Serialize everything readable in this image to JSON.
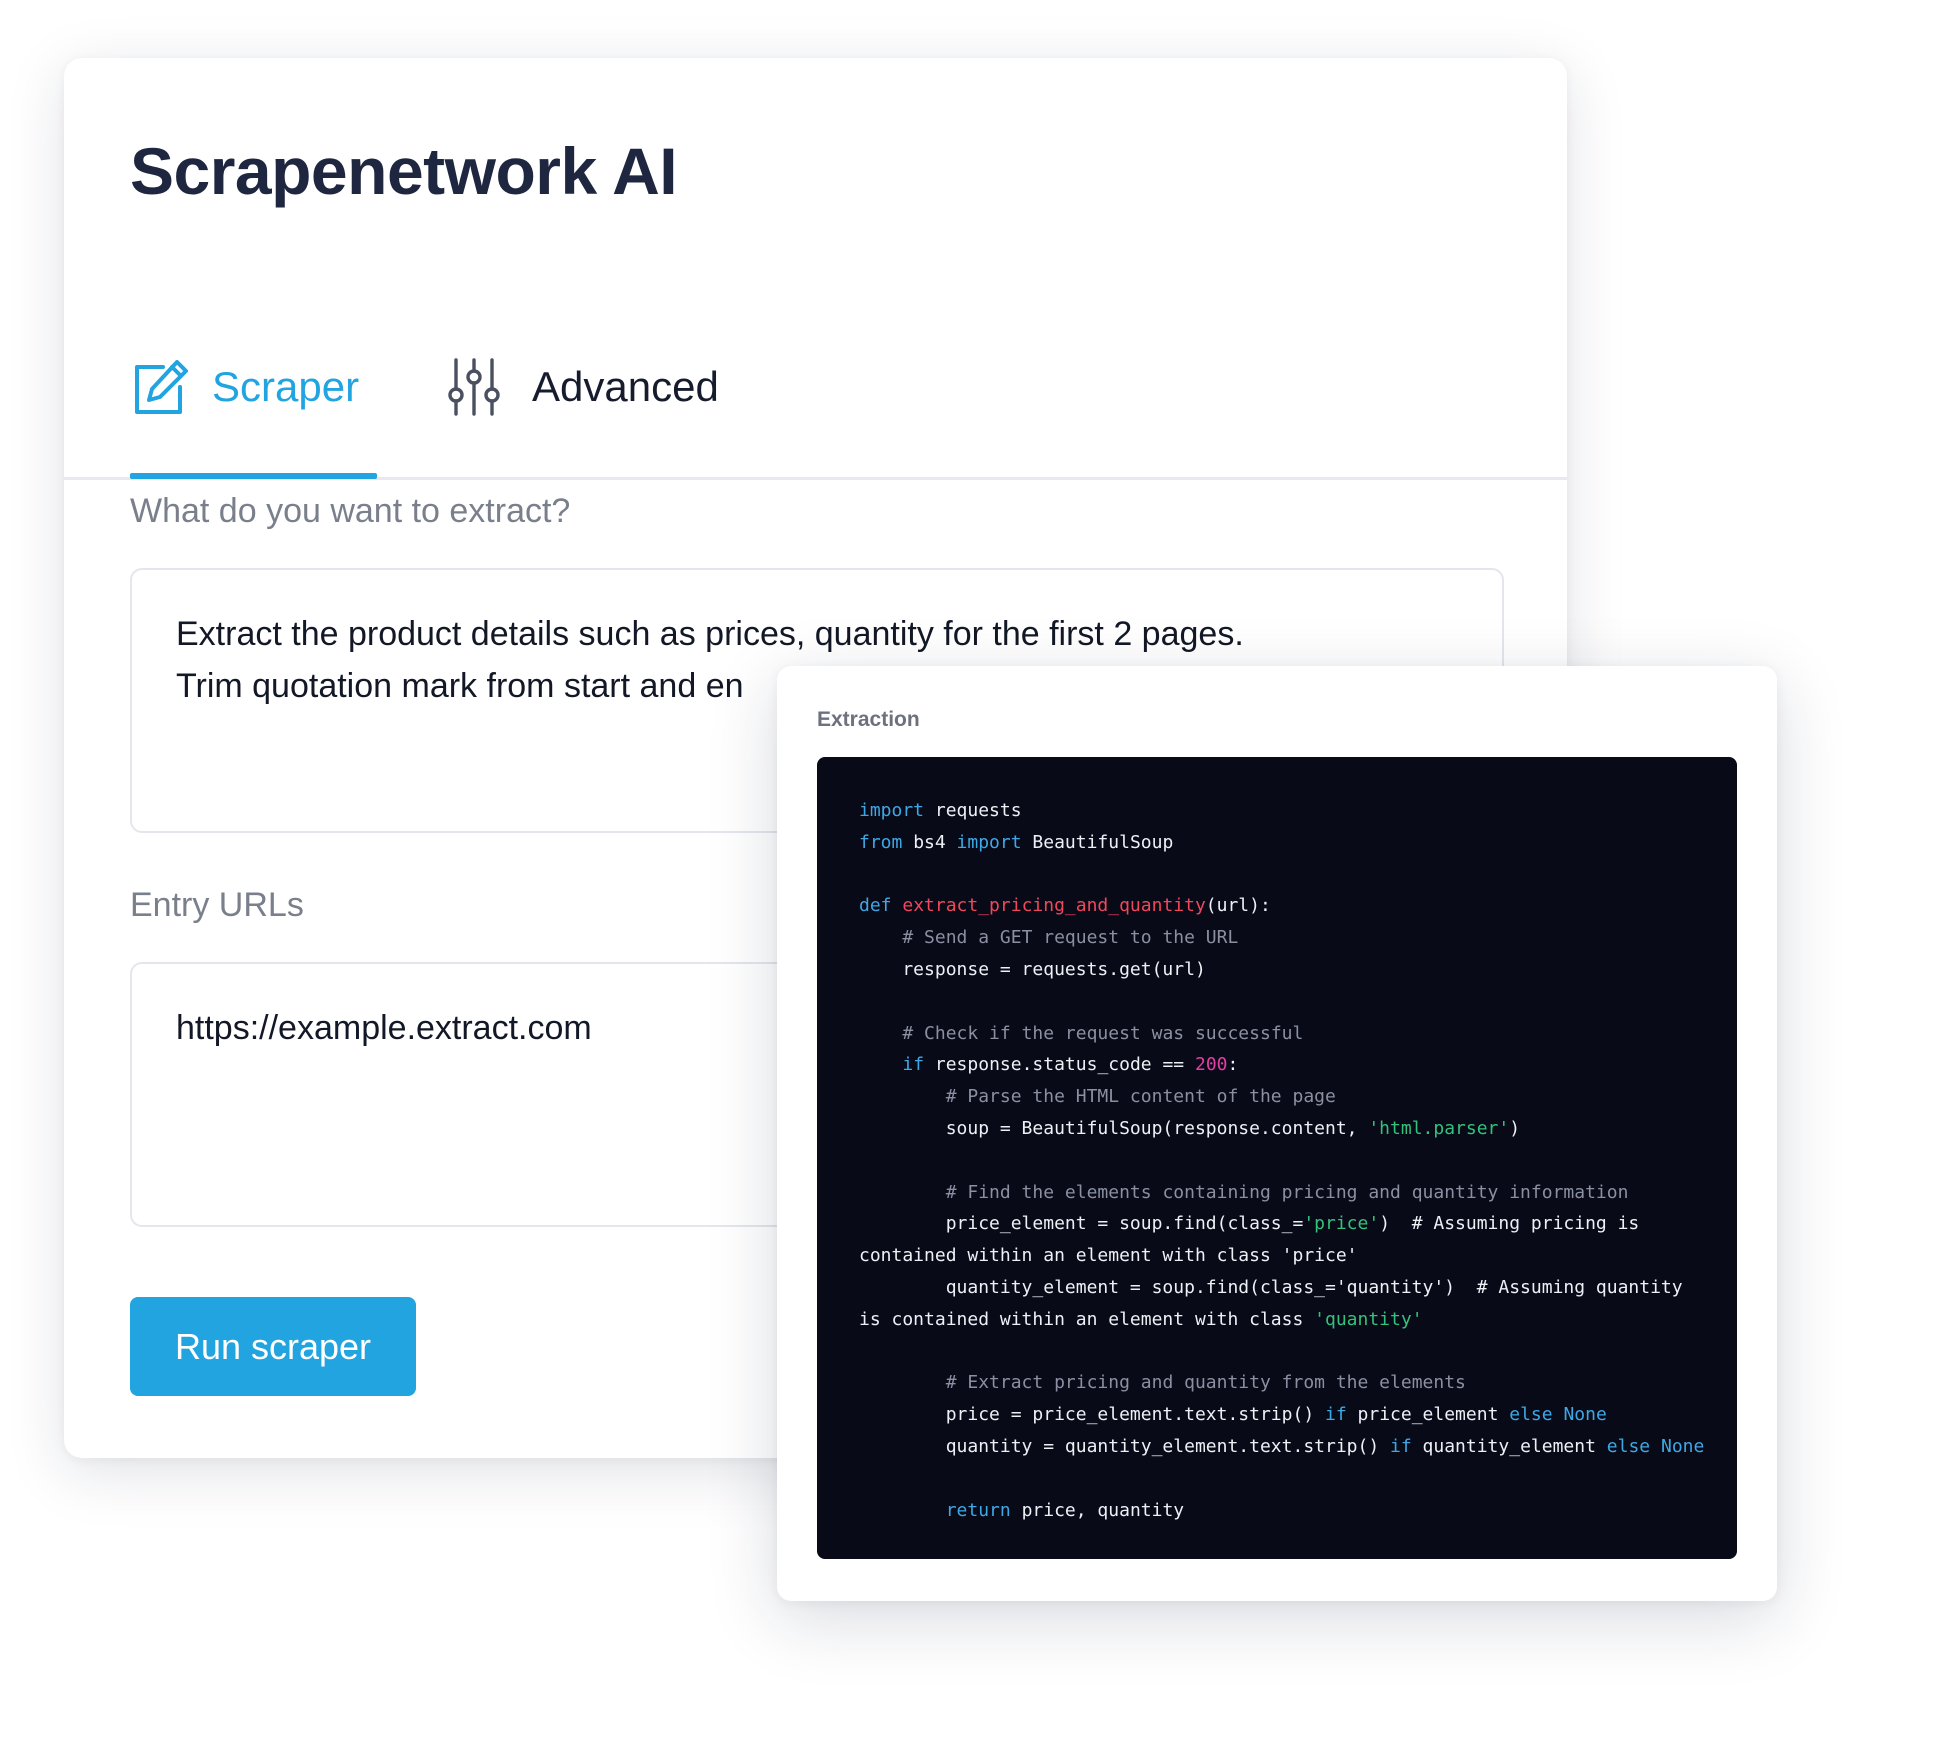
{
  "app": {
    "title": "Scrapenetwork AI"
  },
  "tabs": [
    {
      "label": "Scraper",
      "icon": "edit-icon",
      "active": true
    },
    {
      "label": "Advanced",
      "icon": "sliders-icon",
      "active": false
    }
  ],
  "form": {
    "extract_label": "What do you want to extract?",
    "extract_value_lines": [
      "Extract the product details such as prices, quantity for the first 2 pages.",
      "Trim quotation mark from start and en"
    ],
    "urls_label": "Entry URLs",
    "urls_value": "https://example.extract.com",
    "run_button_label": "Run scraper"
  },
  "extraction": {
    "label": "Extraction",
    "code_lines": [
      [
        [
          "kw",
          "import"
        ],
        [
          "tx",
          " requests"
        ]
      ],
      [
        [
          "kw",
          "from"
        ],
        [
          "tx",
          " bs4 "
        ],
        [
          "kw",
          "import"
        ],
        [
          "tx",
          " BeautifulSoup"
        ]
      ],
      [],
      [
        [
          "kw",
          "def"
        ],
        [
          "tx",
          " "
        ],
        [
          "fn",
          "extract_pricing_and_quantity"
        ],
        [
          "tx",
          "(url):"
        ]
      ],
      [
        [
          "tx",
          "    "
        ],
        [
          "cm",
          "# Send a GET request to the URL"
        ]
      ],
      [
        [
          "tx",
          "    response = requests.get(url)"
        ]
      ],
      [],
      [
        [
          "tx",
          "    "
        ],
        [
          "cm",
          "# Check if the request was successful"
        ]
      ],
      [
        [
          "tx",
          "    "
        ],
        [
          "kw",
          "if"
        ],
        [
          "tx",
          " response.status_code == "
        ],
        [
          "num",
          "200"
        ],
        [
          "tx",
          ":"
        ]
      ],
      [
        [
          "tx",
          "        "
        ],
        [
          "cm",
          "# Parse the HTML content of the page"
        ]
      ],
      [
        [
          "tx",
          "        soup = BeautifulSoup(response.content, "
        ],
        [
          "str",
          "'html.parser'"
        ],
        [
          "tx",
          ")"
        ]
      ],
      [],
      [
        [
          "tx",
          "        "
        ],
        [
          "cm",
          "# Find the elements containing pricing and quantity information"
        ]
      ],
      [
        [
          "tx",
          "        price_element = soup.find(class_="
        ],
        [
          "str",
          "'price'"
        ],
        [
          "tx",
          ")  # Assuming pricing is"
        ]
      ],
      [
        [
          "tx",
          "contained within an element with class 'price'"
        ]
      ],
      [
        [
          "tx",
          "        quantity_element = soup.find(class_='quantity')  # Assuming quantity"
        ]
      ],
      [
        [
          "tx",
          "is contained within an element with class "
        ],
        [
          "str",
          "'quantity'"
        ]
      ],
      [],
      [
        [
          "tx",
          "        "
        ],
        [
          "cm",
          "# Extract pricing and quantity from the elements"
        ]
      ],
      [
        [
          "tx",
          "        price = price_element.text.strip() "
        ],
        [
          "kw",
          "if"
        ],
        [
          "tx",
          " price_element "
        ],
        [
          "kw",
          "else"
        ],
        [
          "tx",
          " "
        ],
        [
          "kw",
          "None"
        ]
      ],
      [
        [
          "tx",
          "        quantity = quantity_element.text.strip() "
        ],
        [
          "kw",
          "if"
        ],
        [
          "tx",
          " quantity_element "
        ],
        [
          "kw",
          "else"
        ],
        [
          "tx",
          " "
        ],
        [
          "kw",
          "None"
        ]
      ],
      [],
      [
        [
          "tx",
          "        "
        ],
        [
          "kw",
          "return"
        ],
        [
          "tx",
          " price, quantity"
        ]
      ]
    ]
  },
  "colors": {
    "accent": "#22a4e0",
    "title": "#1e2640",
    "code_background": "#080a18",
    "code_keyword": "#3ea8e6",
    "code_function": "#f2465b",
    "code_comment": "#8a90a1",
    "code_string": "#33c27b",
    "code_number": "#e23fa4"
  }
}
